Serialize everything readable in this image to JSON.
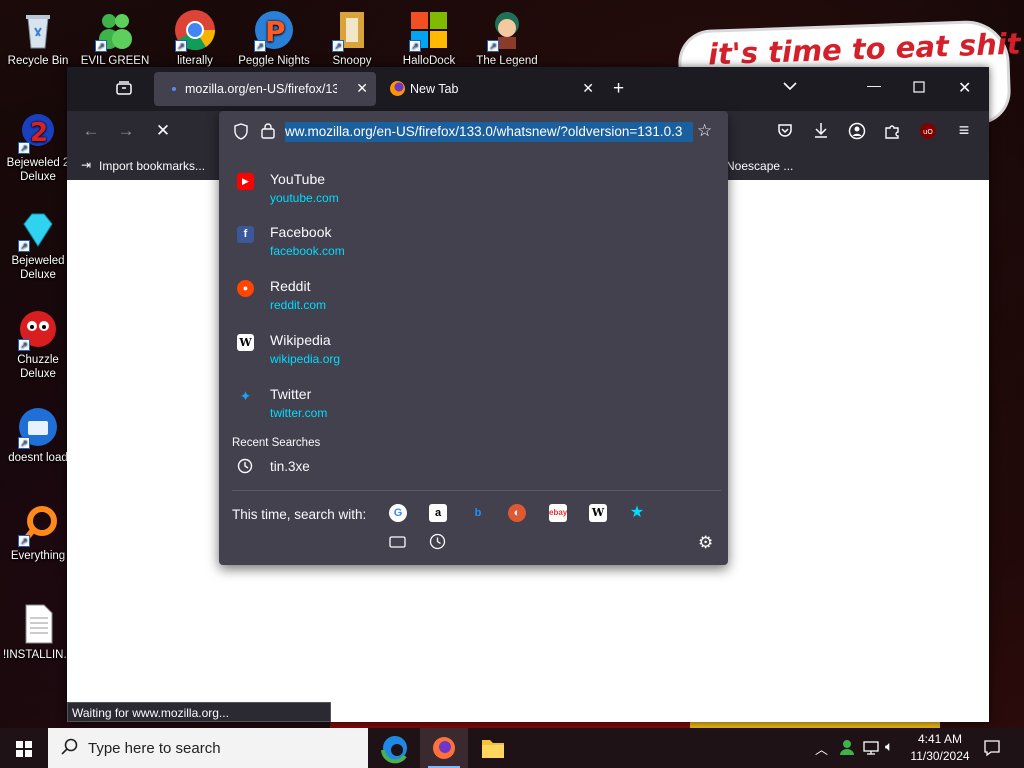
{
  "desktop": {
    "meme_text": "it's time to eat shit",
    "icons": [
      {
        "label": "Recycle Bin"
      },
      {
        "label": "EVIL GREEN"
      },
      {
        "label": "literally"
      },
      {
        "label": "Peggle Nights"
      },
      {
        "label": "Snoopy"
      },
      {
        "label": "HalloDock"
      },
      {
        "label": "The Legend"
      },
      {
        "label": "Bejeweled 2 Deluxe"
      },
      {
        "label": "Bejeweled Deluxe"
      },
      {
        "label": "Chuzzle Deluxe"
      },
      {
        "label": "doesnt load"
      },
      {
        "label": "Everything"
      },
      {
        "label": "!INSTALLIN..."
      }
    ]
  },
  "browser": {
    "tabs": [
      {
        "title": "mozilla.org/en-US/firefox/133.0/",
        "active": true
      },
      {
        "title": "New Tab",
        "active": false
      }
    ],
    "new_tab_symbol": "+",
    "url": "ww.mozilla.org/en-US/firefox/133.0/whatsnew/?oldversion=131.0.3",
    "bookmarks": {
      "import_label": "Import bookmarks...",
      "right_label": "Noescape ..."
    },
    "status": "Waiting for www.mozilla.org...",
    "suggestions": [
      {
        "name": "YouTube",
        "url": "youtube.com",
        "icon": "youtube-icon",
        "color": "#ff0000"
      },
      {
        "name": "Facebook",
        "url": "facebook.com",
        "icon": "facebook-icon",
        "color": "#3b5998"
      },
      {
        "name": "Reddit",
        "url": "reddit.com",
        "icon": "reddit-icon",
        "color": "#ff4500"
      },
      {
        "name": "Wikipedia",
        "url": "wikipedia.org",
        "icon": "wikipedia-icon",
        "color": "#ffffff"
      },
      {
        "name": "Twitter",
        "url": "twitter.com",
        "icon": "twitter-icon",
        "color": "#1da1f2"
      }
    ],
    "recent_heading": "Recent Searches",
    "recent_item": "tin.3xe",
    "search_with_label": "This time, search with:",
    "engines": [
      "google-icon",
      "amazon-icon",
      "bing-icon",
      "duckduckgo-icon",
      "ebay-icon",
      "wikipedia-icon",
      "bookmark-star-icon"
    ]
  },
  "taskbar": {
    "search_placeholder": "Type here to search",
    "time": "4:41 AM",
    "date": "11/30/2024"
  },
  "colors": {
    "accent_link": "#00ddff",
    "url_selection": "#1a5f9e",
    "panel_bg": "#42414d"
  }
}
